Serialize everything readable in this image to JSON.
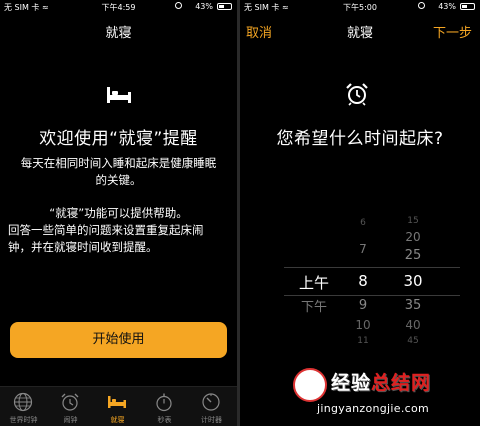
{
  "left": {
    "status": {
      "carrier": "无 SIM 卡 ≈",
      "time": "下午4:59",
      "battery": "43%"
    },
    "nav": {
      "title": "就寝"
    },
    "hero": {
      "icon": "bed-icon",
      "title": "欢迎使用“就寝”提醒"
    },
    "paragraphs": [
      [
        "每天在相同时间入睡和起床是健康睡眠",
        "的关键。"
      ],
      [
        "“就寝”功能可以提供帮助。",
        "回答一些简单的问题来设置重复起床闹",
        "钟，并在就寝时间收到提醒。"
      ]
    ],
    "start_button": "开始使用",
    "tabs": [
      {
        "label": "世界时钟",
        "icon": "globe-icon",
        "active": false
      },
      {
        "label": "闹钟",
        "icon": "alarm-clock-icon",
        "active": false
      },
      {
        "label": "就寝",
        "icon": "bed-icon",
        "active": true
      },
      {
        "label": "秒表",
        "icon": "stopwatch-icon",
        "active": false
      },
      {
        "label": "计时器",
        "icon": "timer-icon",
        "active": false
      }
    ]
  },
  "right": {
    "status": {
      "carrier": "无 SIM 卡 ≈",
      "time": "下午5:00",
      "battery": "43%"
    },
    "nav": {
      "cancel": "取消",
      "title": "就寝",
      "next": "下一步"
    },
    "question": "您希望什么时间起床?",
    "picker": {
      "ampm": [
        "上午",
        "下午"
      ],
      "hours": [
        "6",
        "7",
        "8",
        "9",
        "10",
        "11"
      ],
      "minutes": [
        "15",
        "20",
        "25",
        "30",
        "35",
        "40",
        "45"
      ],
      "selected": {
        "ampm": "上午",
        "hour": "8",
        "minute": "30"
      }
    }
  },
  "watermark": {
    "text_a": "经验",
    "text_b": "总结网",
    "url": "jingyanzongjie.com"
  },
  "colors": {
    "accent": "#f5a623",
    "background": "#000000"
  }
}
